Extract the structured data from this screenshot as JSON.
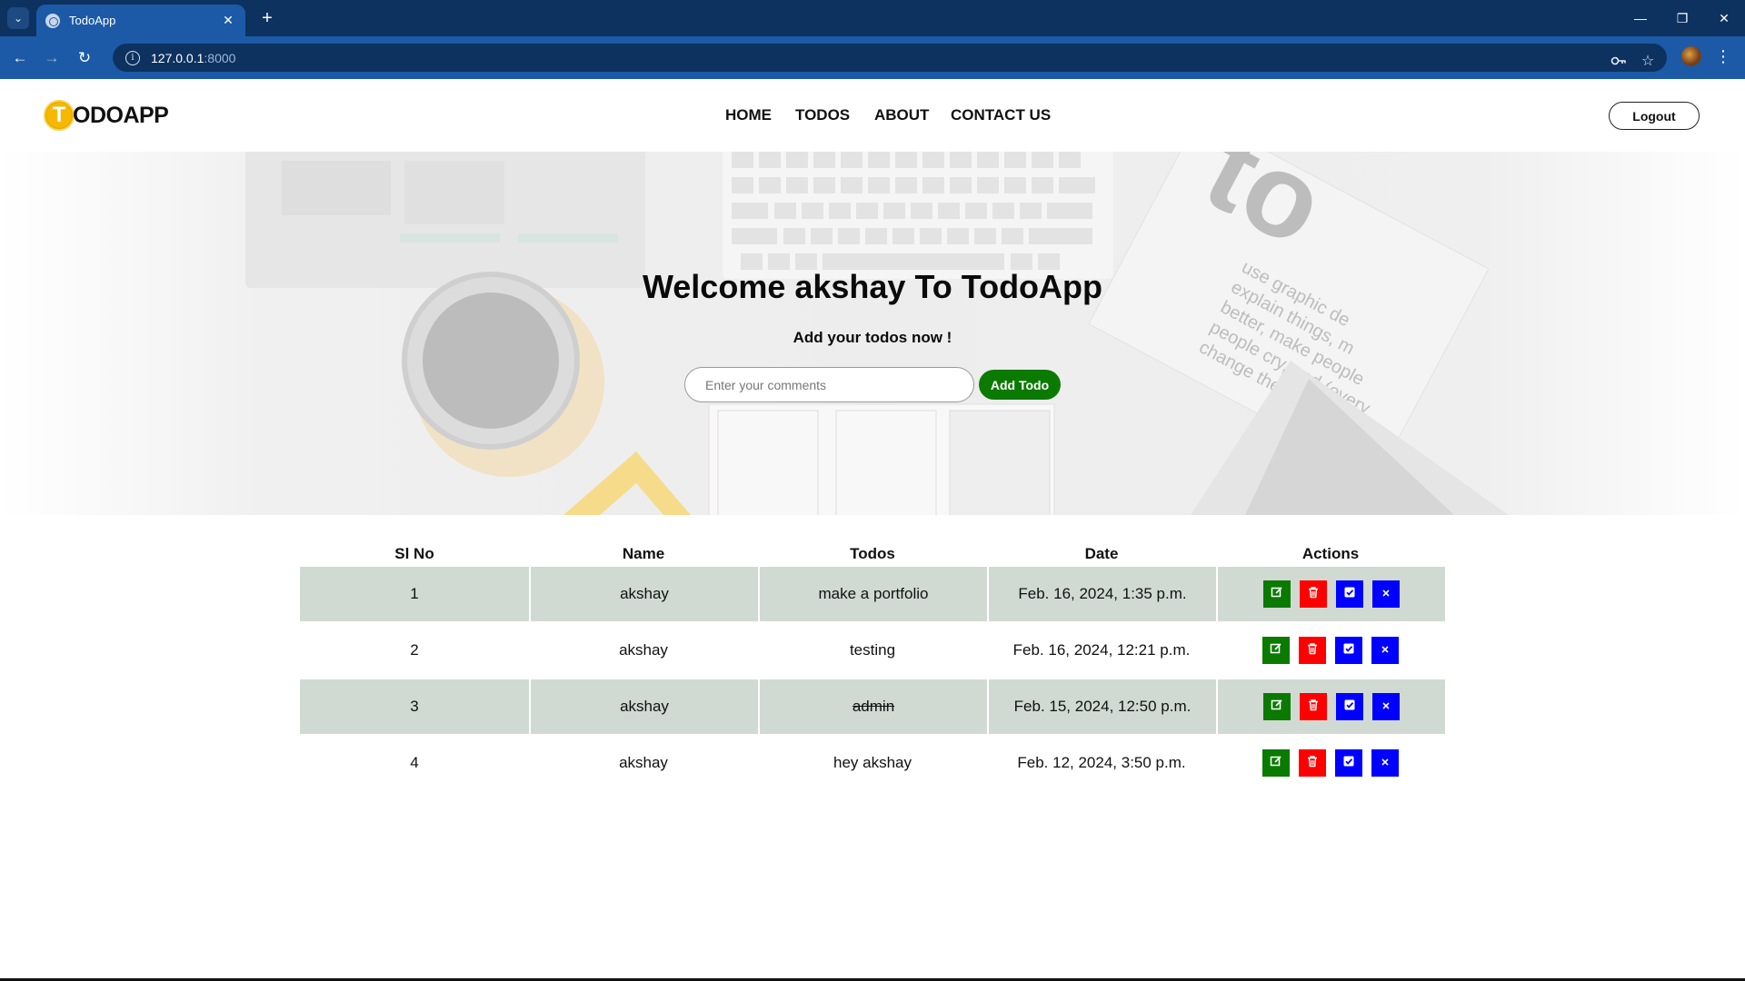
{
  "browser": {
    "tab_title": "TodoApp",
    "url_host": "127.0.0.1",
    "url_port": ":8000",
    "icons": [
      "tab-list-icon",
      "globe-icon",
      "close-icon",
      "plus-icon",
      "minimize-icon",
      "restore-icon",
      "window-close-icon",
      "back-icon",
      "forward-icon",
      "reload-icon",
      "info-icon",
      "key-icon",
      "star-icon",
      "profile-avatar",
      "kebab-menu-icon"
    ]
  },
  "navbar": {
    "logo_letter": "T",
    "logo_text": "ODOAPP",
    "links": [
      "HOME",
      "TODOS",
      "ABOUT",
      "CONTACT US"
    ],
    "logout_label": "Logout"
  },
  "hero": {
    "title": "Welcome akshay To TodoApp",
    "subtitle": "Add your todos now !",
    "input_placeholder": "Enter your comments",
    "input_value": "",
    "add_button_label": "Add Todo"
  },
  "table": {
    "headers": [
      "Sl No",
      "Name",
      "Todos",
      "Date",
      "Actions"
    ],
    "rows": [
      {
        "sl": "1",
        "name": "akshay",
        "todo": "make a portfolio",
        "date": "Feb. 16, 2024, 1:35 p.m.",
        "completed": false
      },
      {
        "sl": "2",
        "name": "akshay",
        "todo": "testing",
        "date": "Feb. 16, 2024, 12:21 p.m.",
        "completed": false
      },
      {
        "sl": "3",
        "name": "akshay",
        "todo": "admin",
        "date": "Feb. 15, 2024, 12:50 p.m.",
        "completed": true
      },
      {
        "sl": "4",
        "name": "akshay",
        "todo": "hey akshay",
        "date": "Feb. 12, 2024, 3:50 p.m.",
        "completed": false
      }
    ],
    "action_icons": [
      "edit-icon",
      "trash-icon",
      "check-icon",
      "x-icon"
    ]
  },
  "colors": {
    "chrome_dark": "#0d3260",
    "chrome_blue": "#1c5aa7",
    "logo_yellow": "#f6b800",
    "green": "#0a7a00",
    "red": "#ff0000",
    "blue": "#0000ff",
    "row_shade": "#d1dad2"
  }
}
